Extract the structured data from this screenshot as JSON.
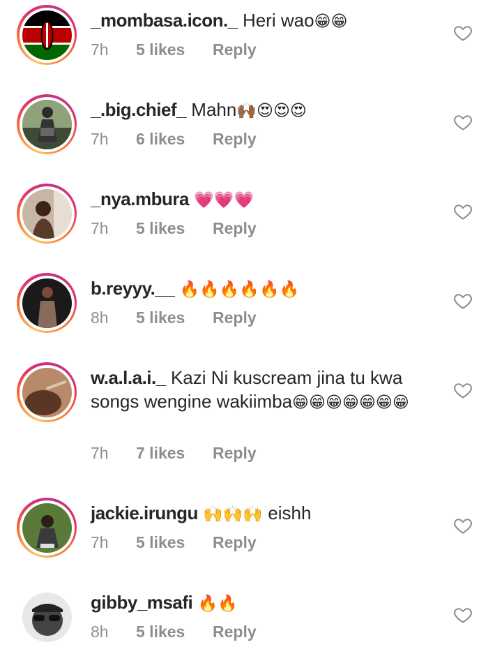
{
  "comments": [
    {
      "username": "_mombasa.icon._",
      "text": "Heri wao",
      "emoji": "😁😁",
      "time": "7h",
      "likes": "5 likes",
      "reply": "Reply",
      "avatar": "kenya-flag-avatar"
    },
    {
      "username": "_.big.chief_",
      "text": "Mahn",
      "emoji": "🙌🏾😍😍😍",
      "time": "7h",
      "likes": "6 likes",
      "reply": "Reply",
      "avatar": "user-photo-avatar"
    },
    {
      "username": "_nya.mbura",
      "text": "",
      "emoji": "💗💗💗",
      "time": "7h",
      "likes": "5 likes",
      "reply": "Reply",
      "avatar": "user-photo-avatar"
    },
    {
      "username": "b.reyyy.__",
      "text": "",
      "emoji": "🔥🔥🔥🔥🔥🔥",
      "time": "8h",
      "likes": "5 likes",
      "reply": "Reply",
      "avatar": "user-photo-avatar"
    },
    {
      "username": "w.a.l.a.i._",
      "text": "Kazi Ni kuscream jina tu kwa songs wengine wakiimba",
      "emoji": "😁😁😁😁😁😁😁",
      "time": "7h",
      "likes": "7 likes",
      "reply": "Reply",
      "avatar": "user-photo-avatar"
    },
    {
      "username": "jackie.irungu",
      "text": "eishh",
      "emoji": "🙌🙌🙌",
      "time": "7h",
      "likes": "5 likes",
      "reply": "Reply",
      "avatar": "user-photo-avatar"
    },
    {
      "username": "gibby_msafi",
      "text": "",
      "emoji": "🔥🔥",
      "time": "8h",
      "likes": "5 likes",
      "reply": "Reply",
      "avatar": "user-photo-avatar"
    }
  ],
  "colors": {
    "text": "#262626",
    "meta": "#8e8e8e",
    "ring_start": "#fdc468",
    "ring_end": "#c13584"
  }
}
